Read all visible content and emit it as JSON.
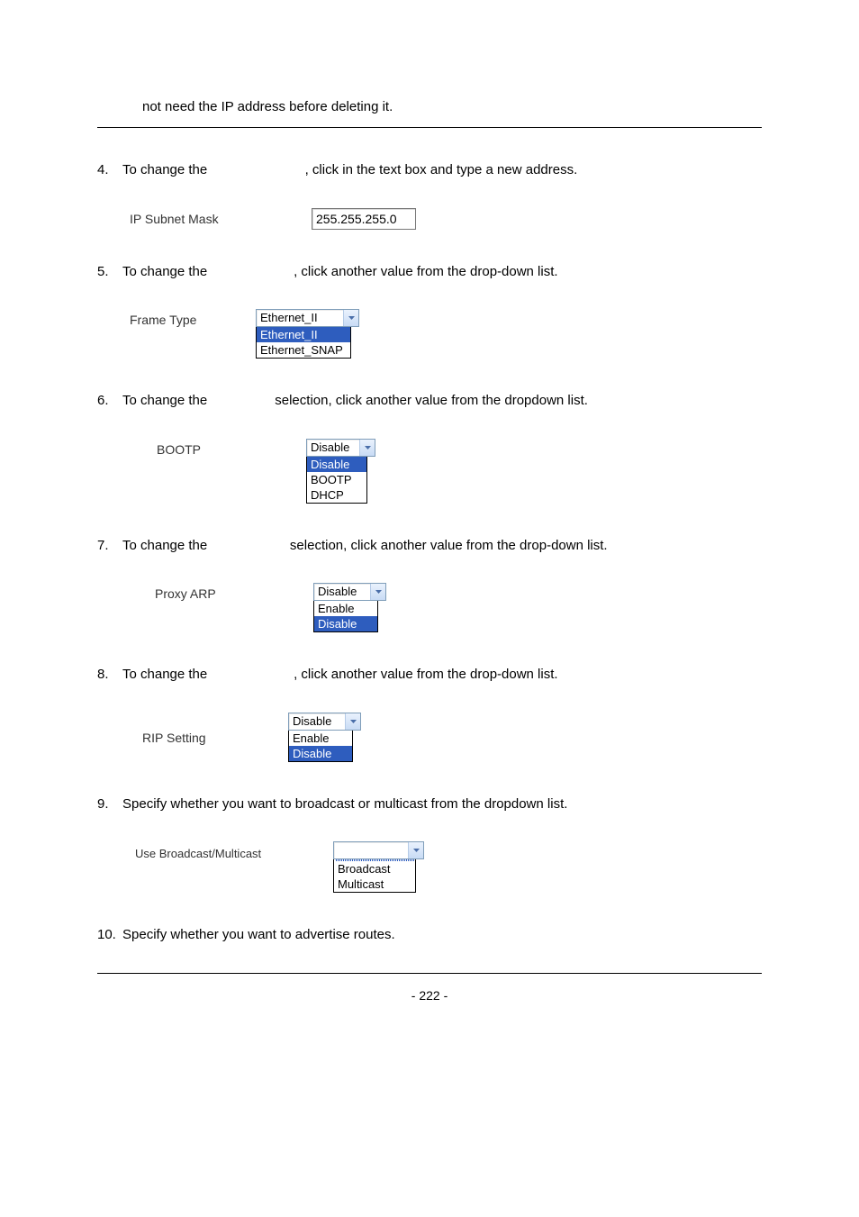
{
  "top_text": "not need the IP address before deleting it.",
  "steps": {
    "s4": {
      "num": "4.",
      "txt": "To change the                          , click in the text box and type a new address."
    },
    "s5": {
      "num": "5.",
      "txt": "To change the                       , click another value from the drop-down list."
    },
    "s6": {
      "num": "6.",
      "txt": "To change the                  selection, click another value from the dropdown list."
    },
    "s7": {
      "num": "7.",
      "txt": "To change the                      selection, click another value from the drop-down list."
    },
    "s8": {
      "num": "8.",
      "txt": "To change the                       , click another value from the drop-down list."
    },
    "s9": {
      "num": "9.",
      "txt": "Specify whether you want to broadcast or multicast from the dropdown list."
    },
    "s10": {
      "num": "10.",
      "txt": "Specify whether you want to advertise routes."
    }
  },
  "figures": {
    "ip_subnet": {
      "label": "IP Subnet Mask",
      "value": "255.255.255.0"
    },
    "frame_type": {
      "label": "Frame Type",
      "selected": "Ethernet_II",
      "opt1": "Ethernet_II",
      "opt2": "Ethernet_SNAP"
    },
    "bootp": {
      "label": "BOOTP",
      "selected": "Disable",
      "opt1": "Disable",
      "opt2": "BOOTP",
      "opt3": "DHCP"
    },
    "proxy_arp": {
      "label": "Proxy ARP",
      "selected": "Disable",
      "opt1": "Enable",
      "opt2": "Disable"
    },
    "rip": {
      "label": "RIP Setting",
      "selected": "Disable",
      "opt1": "Enable",
      "opt2": "Disable"
    },
    "bm": {
      "label": "Use Broadcast/Multicast",
      "selected": "",
      "opt1": "",
      "opt2": "Broadcast",
      "opt3": "Multicast"
    }
  },
  "page_number": "- 222 -"
}
